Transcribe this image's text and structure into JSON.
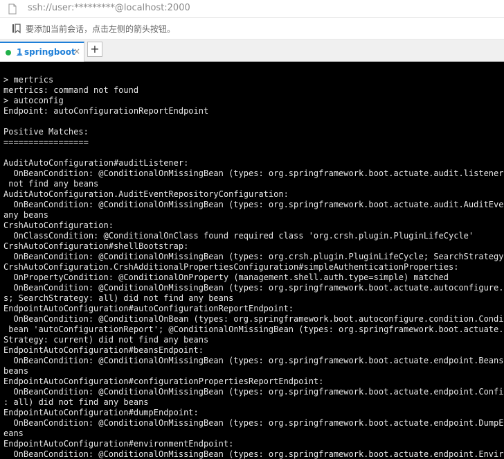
{
  "address_bar": {
    "url": "ssh://user:*********@localhost:2000",
    "icon": "document-icon"
  },
  "hint_bar": {
    "text": "要添加当前会话，点击左侧的箭头按钮。",
    "icon": "bookmark-icon"
  },
  "tabs": [
    {
      "index": "1",
      "label": "springboot",
      "status_color": "#21b14a",
      "close_label": "×"
    }
  ],
  "new_tab_label": "+",
  "terminal": {
    "foreground": "#e8e8e8",
    "background": "#000000",
    "lines": [
      "> mertrics",
      "mertrics: command not found",
      "> autoconfig",
      "Endpoint: autoConfigurationReportEndpoint",
      "",
      "Positive Matches:",
      "=================",
      "",
      "AuditAutoConfiguration#auditListener:",
      "  OnBeanCondition: @ConditionalOnMissingBean (types: org.springframework.boot.actuate.audit.listener.AbstractAuditListener; SearchStrategy: all) did",
      " not find any beans",
      "AuditAutoConfiguration.AuditEventRepositoryConfiguration:",
      "  OnBeanCondition: @ConditionalOnMissingBean (types: org.springframework.boot.actuate.audit.AuditEventRepository; SearchStrategy: all) did not find",
      "any beans",
      "CrshAutoConfiguration:",
      "  OnClassCondition: @ConditionalOnClass found required class 'org.crsh.plugin.PluginLifeCycle'",
      "CrshAutoConfiguration#shellBootstrap:",
      "  OnBeanCondition: @ConditionalOnMissingBean (types: org.crsh.plugin.PluginLifeCycle; SearchStrategy: all) did not find any beans",
      "CrshAutoConfiguration.CrshAdditionalPropertiesConfiguration#simpleAuthenticationProperties:",
      "  OnPropertyCondition: @ConditionalOnProperty (management.shell.auth.type=simple) matched",
      "  OnBeanCondition: @ConditionalOnMissingBean (types: org.springframework.boot.actuate.autoconfigure.ShellProperties$CrshShellAuthenticationPropertie",
      "s; SearchStrategy: all) did not find any beans",
      "EndpointAutoConfiguration#autoConfigurationReportEndpoint:",
      "  OnBeanCondition: @ConditionalOnBean (types: org.springframework.boot.autoconfigure.condition.ConditionEvaluationReport; SearchStrategy: all) found",
      " bean 'autoConfigurationReport'; @ConditionalOnMissingBean (types: org.springframework.boot.actuate.endpoint.AutoConfigurationReportEndpoint; Search",
      "Strategy: current) did not find any beans",
      "EndpointAutoConfiguration#beansEndpoint:",
      "  OnBeanCondition: @ConditionalOnMissingBean (types: org.springframework.boot.actuate.endpoint.BeansEndpoint; SearchStrategy: all) did not find any",
      "beans",
      "EndpointAutoConfiguration#configurationPropertiesReportEndpoint:",
      "  OnBeanCondition: @ConditionalOnMissingBean (types: org.springframework.boot.actuate.endpoint.ConfigurationPropertiesReportEndpoint; SearchStrategy",
      ": all) did not find any beans",
      "EndpointAutoConfiguration#dumpEndpoint:",
      "  OnBeanCondition: @ConditionalOnMissingBean (types: org.springframework.boot.actuate.endpoint.DumpEndpoint; SearchStrategy: all) did not find any b",
      "eans",
      "EndpointAutoConfiguration#environmentEndpoint:",
      "  OnBeanCondition: @ConditionalOnMissingBean (types: org.springframework.boot.actuate.endpoint.EnvironmentEndpoint; SearchStrategy: all) did not find"
    ]
  }
}
